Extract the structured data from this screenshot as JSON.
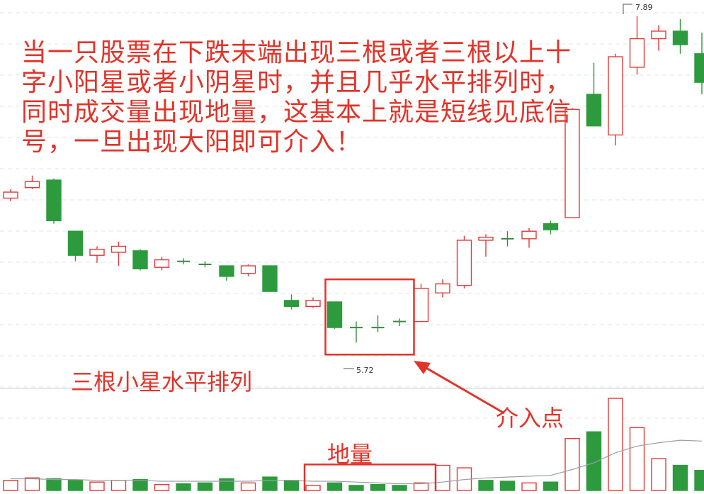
{
  "annotations": {
    "main_text": "当一只股票在下跌末端出现三根或者三根以上十字小阳星或者小阴星时，并且几乎水平排列时，同时成交量出现地量，这基本上就是短线见底信号，一旦出现大阳即可介入！",
    "stars_label": "三根小星水平排列",
    "entry_label": "介入点",
    "volume_label": "地量"
  },
  "markers": {
    "high_label": "7.89",
    "low_label": "5.72"
  },
  "colors": {
    "up": "#e03a3a",
    "down": "#2e9a3e",
    "annotation": "#e0342a",
    "grid": "#dfe6ef",
    "ma_line": "#9aa0a6"
  },
  "chart_data": {
    "type": "candlestick",
    "title": "",
    "ylim": [
      5.5,
      7.95
    ],
    "candles": [
      {
        "o": 6.68,
        "c": 6.72,
        "h": 6.74,
        "l": 6.66,
        "dir": "up"
      },
      {
        "o": 6.75,
        "c": 6.79,
        "h": 6.83,
        "l": 6.74,
        "dir": "up"
      },
      {
        "o": 6.8,
        "c": 6.53,
        "h": 6.81,
        "l": 6.51,
        "dir": "down"
      },
      {
        "o": 6.46,
        "c": 6.3,
        "h": 6.46,
        "l": 6.26,
        "dir": "down"
      },
      {
        "o": 6.3,
        "c": 6.34,
        "h": 6.36,
        "l": 6.25,
        "dir": "up"
      },
      {
        "o": 6.32,
        "c": 6.36,
        "h": 6.39,
        "l": 6.23,
        "dir": "up"
      },
      {
        "o": 6.33,
        "c": 6.21,
        "h": 6.34,
        "l": 6.2,
        "dir": "down"
      },
      {
        "o": 6.22,
        "c": 6.27,
        "h": 6.29,
        "l": 6.2,
        "dir": "up"
      },
      {
        "o": 6.26,
        "c": 6.26,
        "h": 6.28,
        "l": 6.24,
        "dir": "cross"
      },
      {
        "o": 6.24,
        "c": 6.24,
        "h": 6.26,
        "l": 6.22,
        "dir": "cross"
      },
      {
        "o": 6.23,
        "c": 6.16,
        "h": 6.23,
        "l": 6.13,
        "dir": "down"
      },
      {
        "o": 6.18,
        "c": 6.23,
        "h": 6.24,
        "l": 6.16,
        "dir": "up"
      },
      {
        "o": 6.23,
        "c": 6.06,
        "h": 6.23,
        "l": 6.06,
        "dir": "down"
      },
      {
        "o": 6.0,
        "c": 5.96,
        "h": 6.04,
        "l": 5.94,
        "dir": "down"
      },
      {
        "o": 5.96,
        "c": 6.0,
        "h": 6.02,
        "l": 5.95,
        "dir": "up"
      },
      {
        "o": 5.99,
        "c": 5.82,
        "h": 5.99,
        "l": 5.81,
        "dir": "down"
      },
      {
        "o": 5.82,
        "c": 5.82,
        "h": 5.86,
        "l": 5.72,
        "dir": "cross"
      },
      {
        "o": 5.82,
        "c": 5.82,
        "h": 5.9,
        "l": 5.79,
        "dir": "cross"
      },
      {
        "o": 5.86,
        "c": 5.86,
        "h": 5.88,
        "l": 5.83,
        "dir": "cross"
      },
      {
        "o": 5.86,
        "c": 6.08,
        "h": 6.11,
        "l": 5.86,
        "dir": "up"
      },
      {
        "o": 6.05,
        "c": 6.11,
        "h": 6.14,
        "l": 6.02,
        "dir": "up"
      },
      {
        "o": 6.1,
        "c": 6.4,
        "h": 6.43,
        "l": 6.08,
        "dir": "up"
      },
      {
        "o": 6.4,
        "c": 6.42,
        "h": 6.44,
        "l": 6.29,
        "dir": "up"
      },
      {
        "o": 6.41,
        "c": 6.41,
        "h": 6.46,
        "l": 6.36,
        "dir": "cross"
      },
      {
        "o": 6.41,
        "c": 6.46,
        "h": 6.48,
        "l": 6.35,
        "dir": "up"
      },
      {
        "o": 6.51,
        "c": 6.47,
        "h": 6.53,
        "l": 6.44,
        "dir": "down"
      },
      {
        "o": 6.55,
        "c": 7.27,
        "h": 7.28,
        "l": 6.55,
        "dir": "up"
      },
      {
        "o": 7.37,
        "c": 7.16,
        "h": 7.58,
        "l": 7.16,
        "dir": "down"
      },
      {
        "o": 7.1,
        "c": 7.62,
        "h": 7.64,
        "l": 7.03,
        "dir": "up"
      },
      {
        "o": 7.55,
        "c": 7.74,
        "h": 7.89,
        "l": 7.5,
        "dir": "up"
      },
      {
        "o": 7.74,
        "c": 7.79,
        "h": 7.83,
        "l": 7.66,
        "dir": "up"
      },
      {
        "o": 7.79,
        "c": 7.7,
        "h": 7.87,
        "l": 7.64,
        "dir": "down"
      },
      {
        "o": 7.64,
        "c": 7.45,
        "h": 7.78,
        "l": 7.37,
        "dir": "down"
      }
    ],
    "volume": [
      {
        "v": 12,
        "dir": "up"
      },
      {
        "v": 15,
        "dir": "up"
      },
      {
        "v": 14,
        "dir": "down"
      },
      {
        "v": 12,
        "dir": "down"
      },
      {
        "v": 10,
        "dir": "up"
      },
      {
        "v": 12,
        "dir": "up"
      },
      {
        "v": 13,
        "dir": "down"
      },
      {
        "v": 7,
        "dir": "up"
      },
      {
        "v": 8,
        "dir": "down"
      },
      {
        "v": 9,
        "dir": "down"
      },
      {
        "v": 14,
        "dir": "down"
      },
      {
        "v": 9,
        "dir": "up"
      },
      {
        "v": 16,
        "dir": "down"
      },
      {
        "v": 12,
        "dir": "down"
      },
      {
        "v": 6,
        "dir": "up"
      },
      {
        "v": 9,
        "dir": "down"
      },
      {
        "v": 6,
        "dir": "down"
      },
      {
        "v": 7,
        "dir": "down"
      },
      {
        "v": 6,
        "dir": "down"
      },
      {
        "v": 9,
        "dir": "up"
      },
      {
        "v": 30,
        "dir": "up"
      },
      {
        "v": 27,
        "dir": "up"
      },
      {
        "v": 12,
        "dir": "down"
      },
      {
        "v": 11,
        "dir": "down"
      },
      {
        "v": 9,
        "dir": "up"
      },
      {
        "v": 10,
        "dir": "down"
      },
      {
        "v": 62,
        "dir": "up"
      },
      {
        "v": 70,
        "dir": "down"
      },
      {
        "v": 110,
        "dir": "up"
      },
      {
        "v": 75,
        "dir": "up"
      },
      {
        "v": 38,
        "dir": "up"
      },
      {
        "v": 30,
        "dir": "down"
      },
      {
        "v": 24,
        "dir": "down"
      }
    ],
    "volume_ma": [
      14,
      14,
      13,
      13,
      12,
      12,
      12,
      11,
      11,
      11,
      11,
      11,
      12,
      12,
      11,
      11,
      10,
      9,
      8,
      8,
      10,
      13,
      15,
      16,
      17,
      18,
      25,
      33,
      45,
      53,
      57,
      60,
      59
    ],
    "highlight_boxes": [
      {
        "from": 15,
        "to": 18,
        "price_top": 6.14,
        "price_bottom": 5.64
      },
      {
        "from": 14,
        "to": 19,
        "volume_top": 31
      }
    ]
  }
}
